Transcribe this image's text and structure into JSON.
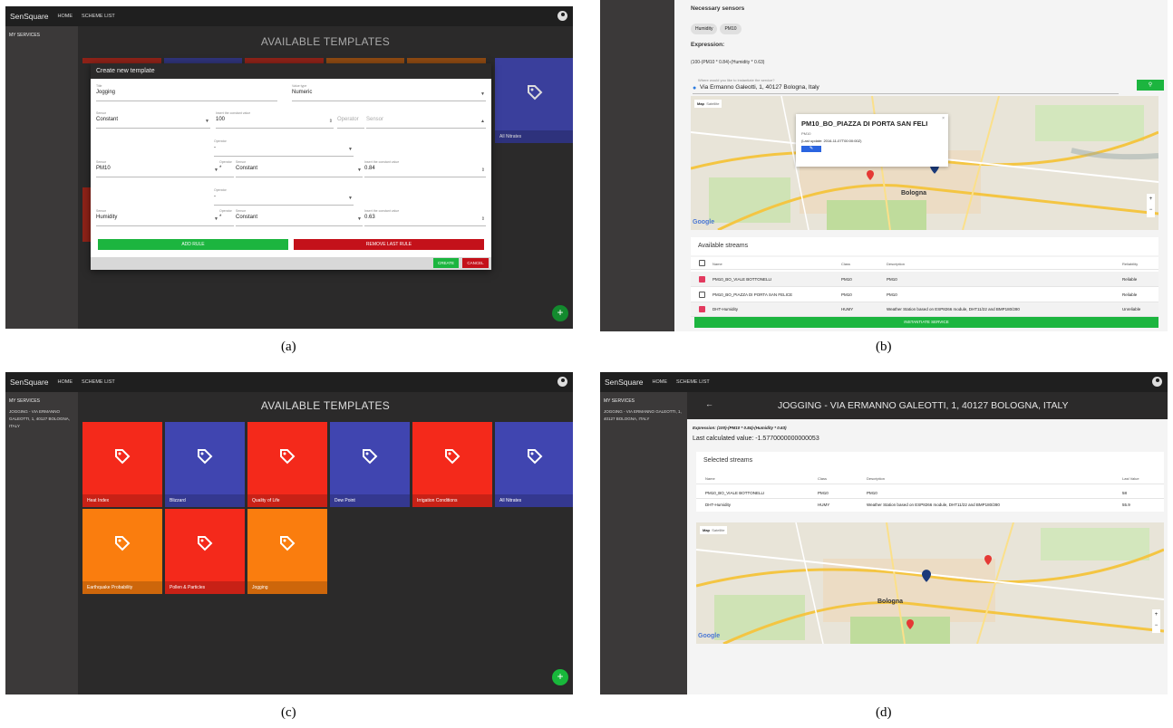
{
  "captions": [
    "(a)",
    "(b)",
    "(c)",
    "(d)"
  ],
  "app": {
    "brand": "SenSquare",
    "nav_home": "HOME",
    "nav_scheme": "SCHEME LIST",
    "sidebar_title": "MY SERVICES"
  },
  "panel_a": {
    "title": "AVAILABLE TEMPLATES",
    "modal_title": "Create new template",
    "title_label": "Title",
    "title_value": "Jogging",
    "value_type_label": "Value type",
    "value_type_value": "Numeric",
    "sensor_label": "Sensor",
    "sensor1_value": "Constant",
    "constant_label": "Insert the constant value",
    "constant1_value": "100",
    "operator_placeholder": "Operator",
    "sensor_placeholder": "Sensor",
    "operator_label": "Operator",
    "operator_dash": "-",
    "sensor2_value": "PM10",
    "operator_star": "*",
    "sensor2b_value": "Constant",
    "constant2_value": "0.84",
    "sensor3_value": "Humidity",
    "sensor3b_value": "Constant",
    "constant3_value": "0.63",
    "add_rule": "ADD RULE",
    "remove_rule": "REMOVE LAST RULE",
    "create": "CREATE",
    "cancel": "CANCEL",
    "bg_tile_label": "All Nitrates"
  },
  "panel_b": {
    "necessary_sensors": "Necessary sensors",
    "chips": [
      "Humidity",
      "PM10"
    ],
    "expression_label": "Expression:",
    "expression": "(100-(PM10 * 0.84)-(Humidity * 0.63)",
    "location_prompt": "Where would you like to instantiate the service?",
    "location_value": "Via Ermanno Galeotti, 1, 40127 Bologna, Italy",
    "map_tab_map": "Map",
    "map_tab_sat": "Satellite",
    "popup_title": "PM10_BO_PIAZZA DI PORTA SAN FELI",
    "popup_sub": "PM10",
    "popup_update": "(Last update: 2016-11-07T00:00:00Z)",
    "map_city": "Bologna",
    "google": "Google",
    "streams_title": "Available streams",
    "cols": [
      "Name",
      "Class",
      "Description",
      "Reliability"
    ],
    "rows": [
      {
        "name": "PM10_BO_VIALE BOTTONELLI",
        "class": "PM10",
        "desc": "PM10",
        "rel": "Reliable",
        "checked": true
      },
      {
        "name": "PM10_BO_PIAZZA DI PORTA SAN FELICE",
        "class": "PM10",
        "desc": "PM10",
        "rel": "Reliable",
        "checked": false
      },
      {
        "name": "DHT-Humidity",
        "class": "HUMY",
        "desc": "Weather Station based on ESP8266 module, DHT11/22 and BMP180/280",
        "rel": "Unreliable",
        "checked": true
      }
    ],
    "instantiate": "INSTANTIATE SERVICE"
  },
  "panel_c": {
    "title": "AVAILABLE TEMPLATES",
    "sidebar_item": "JOGGING - VIA ERMANNO GALEOTTI, 1, 40127 BOLOGNA, ITALY",
    "tiles": [
      {
        "label": "Heat Index",
        "color": "#f4291b"
      },
      {
        "label": "Blizzard",
        "color": "#4045b0"
      },
      {
        "label": "Quality of Life",
        "color": "#f4291b"
      },
      {
        "label": "Dew Point",
        "color": "#4045b0"
      },
      {
        "label": "Irrigation Conditions",
        "color": "#f4291b"
      },
      {
        "label": "All Nitrates",
        "color": "#4045b0"
      },
      {
        "label": "Earthquake Probability",
        "color": "#fa7d0e"
      },
      {
        "label": "Pollen & Particles",
        "color": "#f4291b"
      },
      {
        "label": "Jogging",
        "color": "#fa7d0e"
      }
    ]
  },
  "panel_d": {
    "back": "←",
    "title": "JOGGING - VIA ERMANNO GALEOTTI, 1, 40127 BOLOGNA, ITALY",
    "sidebar_item": "JOGGING - VIA ERMANNO GALEOTTI, 1, 40127 BOLOGNA, ITALY",
    "expression": "Expression: (100)-(PM10 * 0.84)-(Humidity * 0.63)",
    "last_value": "Last calculated value: -1.5770000000000053",
    "streams_title": "Selected streams",
    "cols": [
      "Name",
      "Class",
      "Description",
      "Last Value"
    ],
    "rows": [
      {
        "name": "PM10_BO_VIALE BOTTONELLI",
        "class": "PM10",
        "desc": "PM10",
        "val": "58"
      },
      {
        "name": "DHT-Humidity",
        "class": "HUMY",
        "desc": "Weather Station based on ESP8266 module, DHT11/22 and BMP180/280",
        "val": "55.9"
      }
    ],
    "map_tab_map": "Map",
    "map_tab_sat": "Satellite",
    "map_city": "Bologna",
    "google": "Google"
  }
}
